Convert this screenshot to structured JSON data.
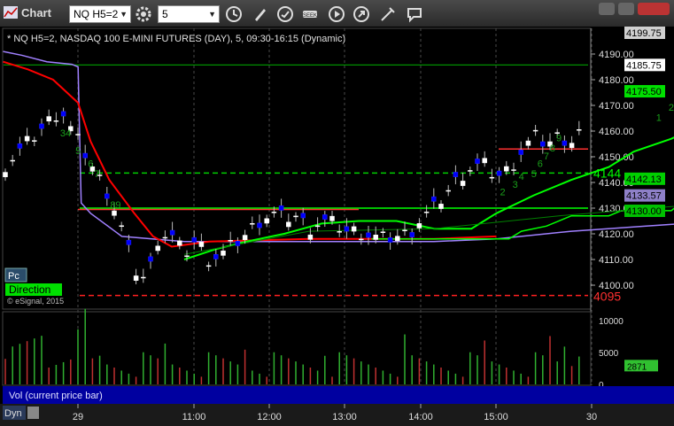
{
  "window": {
    "title": "Chart",
    "symbol_box": "NQ H5=2",
    "interval_box": "5"
  },
  "chart_header": "* NQ H5=2, NASDAQ 100 E-MINI FUTURES (DAY), 5, 09:30-16:15 (Dynamic)",
  "watermark": "© eSignal, 2015",
  "buttons": {
    "pc": "Pc",
    "direction": "Direction"
  },
  "volume_label": "Vol (current price bar)",
  "dyn_label": "Dyn",
  "colors": {
    "background": "#000000",
    "up_candle": "#ffffff",
    "down_candle": "#0000ff",
    "red_line": "#ff0000",
    "green_line": "#00ff00",
    "purple_line": "#a080ff",
    "dark_green_line": "#008000",
    "count_green": "#1aa01a",
    "count_magenta": "#ff00ff"
  },
  "chart_data": {
    "type": "candlestick",
    "price_axis": {
      "ticks": [
        "4190.00",
        "4180.00",
        "4170.00",
        "4160.00",
        "4150.00",
        "4140.00",
        "4130.00",
        "4120.00",
        "4110.00",
        "4100.00"
      ],
      "range": [
        4095,
        4200
      ]
    },
    "price_labels": {
      "last_price": "4185.75",
      "top_box": "4199.75",
      "green_trail": "4175.50",
      "lower_green": "4142.13",
      "purple": "4133.57",
      "green_flat": "4130.00"
    },
    "levels": [
      {
        "label": "4144",
        "value": 4144
      },
      {
        "label": "4095",
        "value": 4096
      }
    ],
    "time_axis": [
      "29",
      "11:00",
      "12:00",
      "13:00",
      "14:00",
      "15:00",
      "30"
    ],
    "volume_axis": [
      "10000",
      "5000",
      "0"
    ],
    "volume_current": "2871",
    "counts": [
      {
        "text": "34",
        "t": 1,
        "price": 4158,
        "color": "green"
      },
      {
        "text": "5",
        "t": 3,
        "price": 4151,
        "color": "green"
      },
      {
        "text": "6",
        "t": 5,
        "price": 4146,
        "color": "green"
      },
      {
        "text": "7",
        "t": 6,
        "price": 4142,
        "color": "green"
      },
      {
        "text": "89",
        "t": 9,
        "price": 4130,
        "color": "green"
      },
      {
        "text": "2",
        "t": 71,
        "price": 4135,
        "color": "green"
      },
      {
        "text": "3",
        "t": 73,
        "price": 4138,
        "color": "green"
      },
      {
        "text": "4",
        "t": 74,
        "price": 4141,
        "color": "green"
      },
      {
        "text": "5",
        "t": 76,
        "price": 4142,
        "color": "green"
      },
      {
        "text": "6",
        "t": 77,
        "price": 4146,
        "color": "green"
      },
      {
        "text": "7",
        "t": 78,
        "price": 4149,
        "color": "green"
      },
      {
        "text": "8",
        "t": 79,
        "price": 4152,
        "color": "green"
      },
      {
        "text": "9",
        "t": 80,
        "price": 4156,
        "color": "green"
      },
      {
        "text": "1",
        "t": 96,
        "price": 4164,
        "color": "green"
      },
      {
        "text": "2",
        "t": 98,
        "price": 4168,
        "color": "green"
      },
      {
        "text": "34",
        "t": 100,
        "price": 4168,
        "color": "green"
      },
      {
        "text": "1",
        "t": 99,
        "price": 4172,
        "color": "green"
      },
      {
        "text": "5",
        "t": 103,
        "price": 4178,
        "color": "green"
      },
      {
        "text": "67",
        "t": 105,
        "price": 4181,
        "color": "green"
      },
      {
        "text": "8",
        "t": 107,
        "price": 4186,
        "color": "green"
      },
      {
        "text": "9",
        "t": 108,
        "price": 4187,
        "color": "green"
      },
      {
        "text": "1",
        "t": 113,
        "price": 4188,
        "color": "green"
      },
      {
        "text": "2",
        "t": 115,
        "price": 4185,
        "color": "green"
      },
      {
        "text": "1",
        "t": 99,
        "price": 4177,
        "color": "magenta"
      },
      {
        "text": "2",
        "t": 103,
        "price": 4184,
        "color": "magenta"
      },
      {
        "text": "3",
        "t": 107,
        "price": 4193,
        "color": "magenta"
      },
      {
        "text": "(R)",
        "t": 107,
        "price": 4198,
        "color": "magenta"
      }
    ]
  }
}
